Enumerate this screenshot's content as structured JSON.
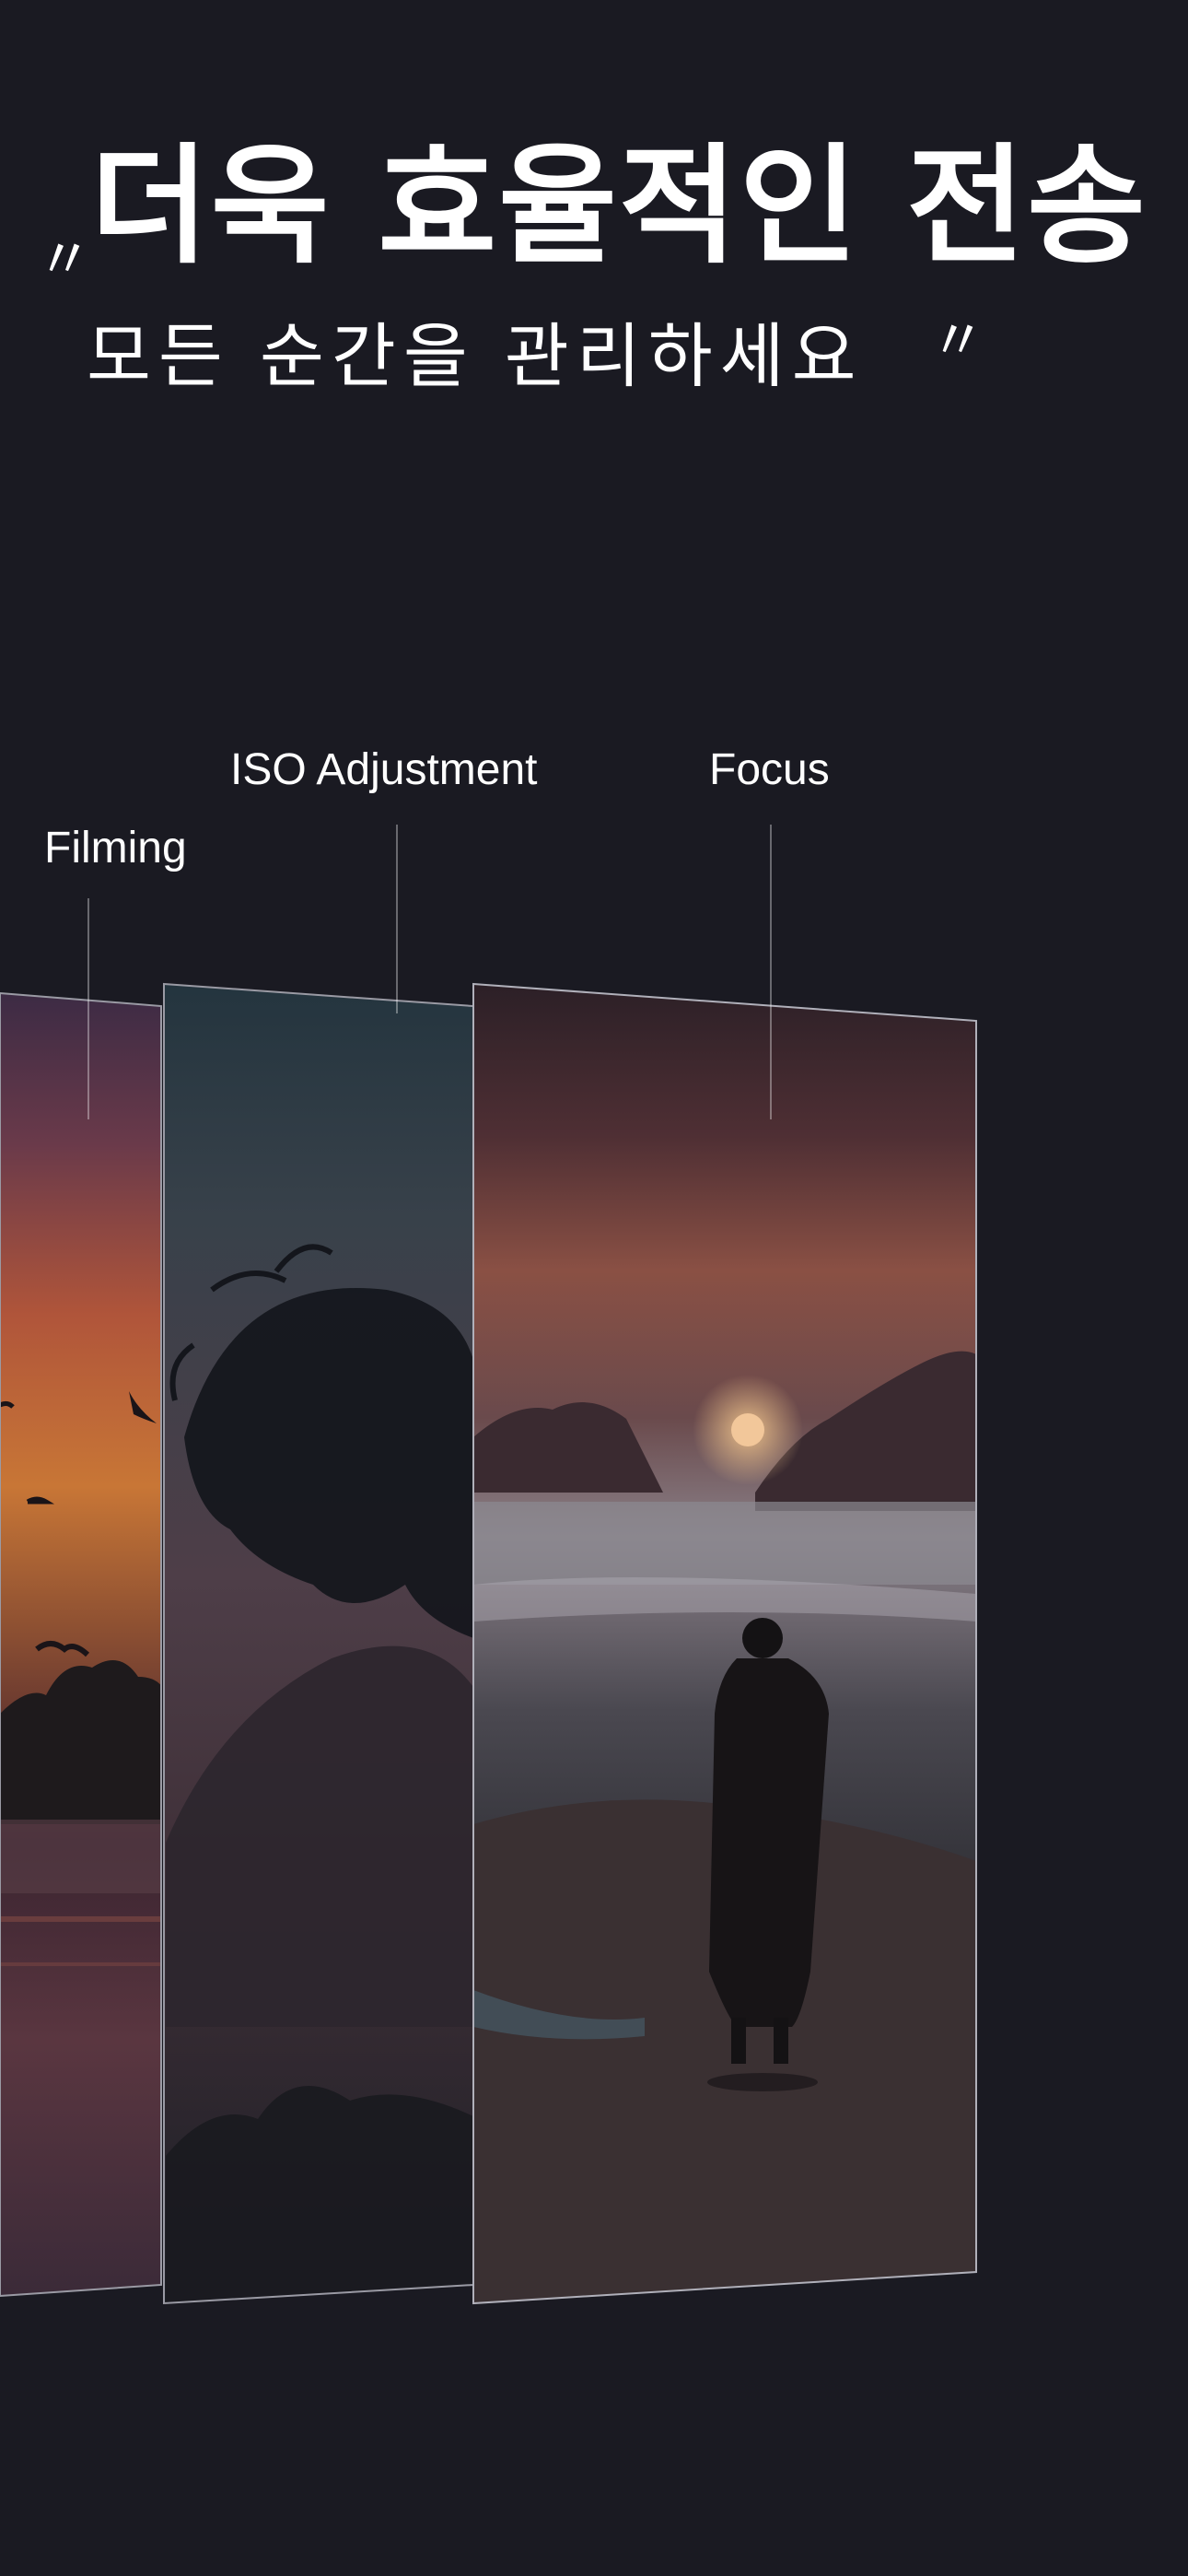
{
  "hero": {
    "headline": "더욱 효율적인 전송",
    "subline": "모든 순간을 관리하세요",
    "quote_open": "〃",
    "quote_close": "〃"
  },
  "labels": {
    "filming": "Filming",
    "iso": "ISO Adjustment",
    "focus": "Focus"
  },
  "panels": [
    {
      "name": "filming-panel",
      "depicts": "sunset-lake-with-birds"
    },
    {
      "name": "iso-panel",
      "depicts": "woman-silhouette-double-exposure"
    },
    {
      "name": "focus-panel",
      "depicts": "man-on-beach-at-sunset"
    }
  ],
  "colors": {
    "background": "#1a1a22",
    "text": "#ffffff"
  }
}
